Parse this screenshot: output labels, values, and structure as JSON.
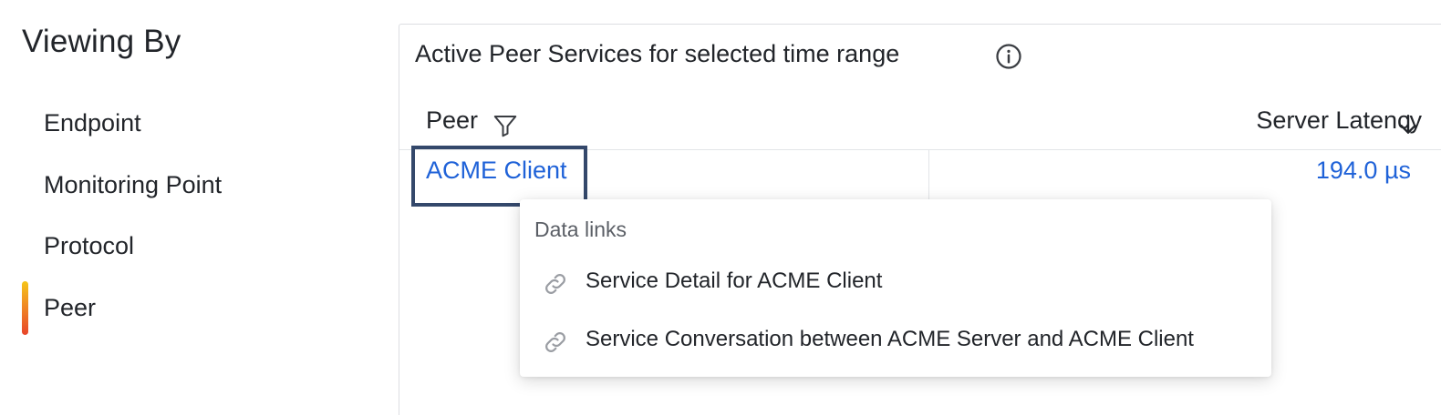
{
  "sidebar": {
    "title": "Viewing By",
    "items": [
      {
        "label": "Endpoint"
      },
      {
        "label": "Monitoring Point"
      },
      {
        "label": "Protocol"
      },
      {
        "label": "Peer"
      }
    ],
    "active_index": 3
  },
  "panel": {
    "title": "Active Peer Services for selected time range",
    "columns": {
      "peer": "Peer",
      "latency": "Server Latency"
    },
    "rows": [
      {
        "peer": "ACME Client",
        "latency": "194.0 µs"
      }
    ]
  },
  "popup": {
    "heading": "Data links",
    "items": [
      {
        "label": "Service Detail for ACME Client"
      },
      {
        "label": "Service Conversation between ACME Server and ACME Client"
      }
    ]
  },
  "colors": {
    "link": "#1f62d8",
    "focus_border": "#34486b",
    "indicator_top": "#f5c518",
    "indicator_bottom": "#e8452a"
  },
  "icons": {
    "info": "info-circle-icon",
    "filter": "filter-funnel-icon",
    "sort": "arrow-down-icon",
    "link": "chain-link-icon"
  }
}
